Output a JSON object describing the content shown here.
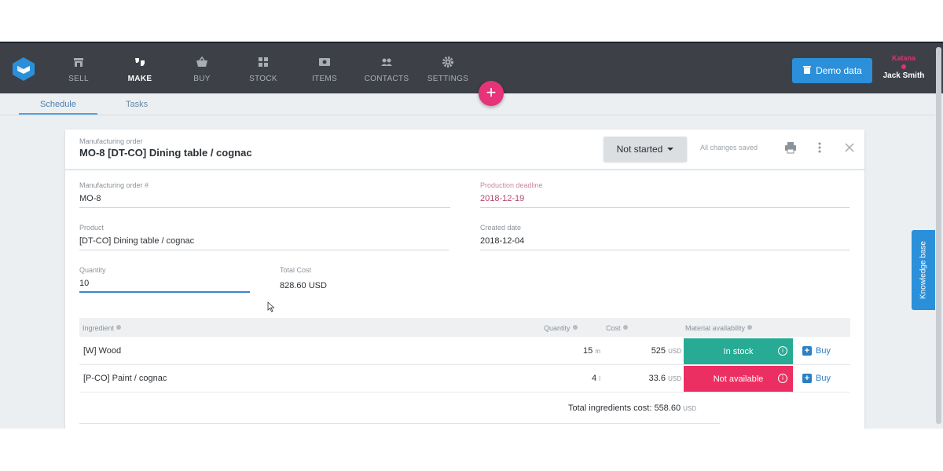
{
  "nav": {
    "items": [
      {
        "label": "SELL",
        "icon": "store-icon"
      },
      {
        "label": "MAKE",
        "icon": "make-icon"
      },
      {
        "label": "BUY",
        "icon": "basket-icon"
      },
      {
        "label": "STOCK",
        "icon": "stock-icon"
      },
      {
        "label": "ITEMS",
        "icon": "items-icon"
      },
      {
        "label": "CONTACTS",
        "icon": "contacts-icon"
      },
      {
        "label": "SETTINGS",
        "icon": "gear-icon"
      }
    ],
    "active": "MAKE",
    "demo_button": "Demo data",
    "brand_tag": "Katana",
    "user_name": "Jack Smith",
    "fab_label": "+"
  },
  "tabs": [
    {
      "label": "Schedule",
      "active": true
    },
    {
      "label": "Tasks",
      "active": false
    }
  ],
  "knowledge_base": "Knowledge base",
  "order": {
    "caption": "Manufacturing order",
    "title": "MO-8 [DT-CO] Dining table / cognac",
    "status": "Not started",
    "saved_text": "All changes saved",
    "fields": {
      "mo_number": {
        "label": "Manufacturing order #",
        "value": "MO-8"
      },
      "deadline": {
        "label": "Production deadline",
        "value": "2018-12-19"
      },
      "product": {
        "label": "Product",
        "value": "[DT-CO] Dining table / cognac"
      },
      "created": {
        "label": "Created date",
        "value": "2018-12-04"
      },
      "quantity": {
        "label": "Quantity",
        "value": "10"
      },
      "total_cost": {
        "label": "Total Cost",
        "value": "828.60 USD"
      }
    }
  },
  "ingredients": {
    "headers": {
      "ingredient": "Ingredient",
      "quantity": "Quantity",
      "cost": "Cost",
      "availability": "Material availability"
    },
    "rows": [
      {
        "name": "[W] Wood",
        "qty": "15",
        "qty_unit": "m",
        "cost": "525",
        "currency": "USD",
        "availability": "In stock",
        "buy": "Buy"
      },
      {
        "name": "[P-CO] Paint / cognac",
        "qty": "4",
        "qty_unit": "l",
        "cost": "33.6",
        "currency": "USD",
        "availability": "Not available",
        "buy": "Buy"
      }
    ],
    "total_label": "Total ingredients cost: 558.60",
    "total_currency": "USD"
  },
  "colors": {
    "topbar": "#3d4147",
    "accent_blue": "#2b90d9",
    "fab_pink": "#e6337a",
    "in_stock": "#27ab94",
    "not_available": "#ec2f62"
  }
}
